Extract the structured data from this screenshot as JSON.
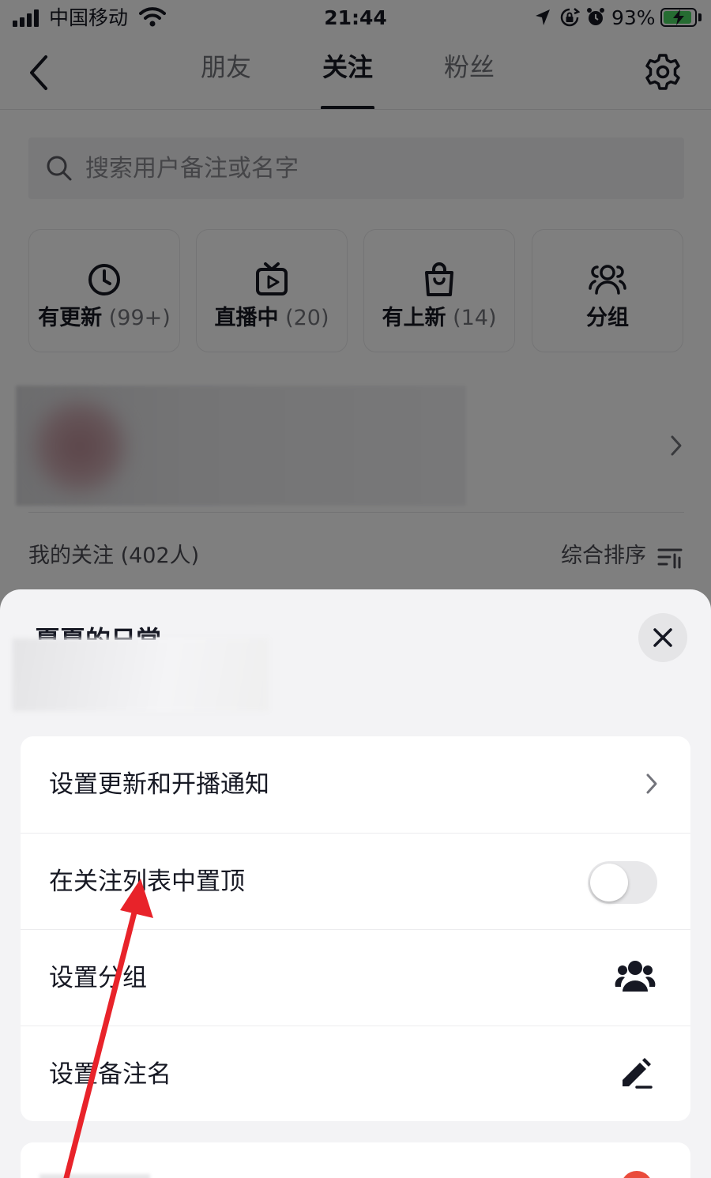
{
  "status_bar": {
    "carrier": "中国移动",
    "time": "21:44",
    "battery_percent": "93%",
    "battery_level": 0.93,
    "icons": [
      "signal-icon",
      "wifi-icon",
      "location-icon",
      "orientation-lock-icon",
      "alarm-icon",
      "battery-icon"
    ]
  },
  "header": {
    "tabs": [
      {
        "label": "朋友",
        "active": false
      },
      {
        "label": "关注",
        "active": true
      },
      {
        "label": "粉丝",
        "active": false
      }
    ],
    "back_icon": "chevron-left-icon",
    "settings_icon": "gear-icon"
  },
  "search": {
    "placeholder": "搜索用户备注或名字",
    "value": ""
  },
  "quick_filters": [
    {
      "name": "有更新",
      "count": "(99+)",
      "icon": "clock-icon"
    },
    {
      "name": "直播中",
      "count": "(20)",
      "icon": "tv-play-icon"
    },
    {
      "name": "有上新",
      "count": "(14)",
      "icon": "shopping-bag-icon"
    },
    {
      "name": "分组",
      "count": "",
      "icon": "group-icon"
    }
  ],
  "following": {
    "count_label": "我的关注 (402人)",
    "sort_label": "综合排序"
  },
  "sheet": {
    "title": "夏夏的日常",
    "options": [
      {
        "label": "设置更新和开播通知",
        "control": "chevron-right-icon"
      },
      {
        "label": "在关注列表中置顶",
        "control": "toggle",
        "toggle_on": false
      },
      {
        "label": "设置分组",
        "control": "group-icon"
      },
      {
        "label": "设置备注名",
        "control": "pencil-icon"
      }
    ]
  },
  "colors": {
    "text_primary": "#161823",
    "text_secondary": "#73747b",
    "sheet_background": "#f3f3f5",
    "annotation_arrow": "#e8232a",
    "badge_red": "#ea4b3b"
  }
}
